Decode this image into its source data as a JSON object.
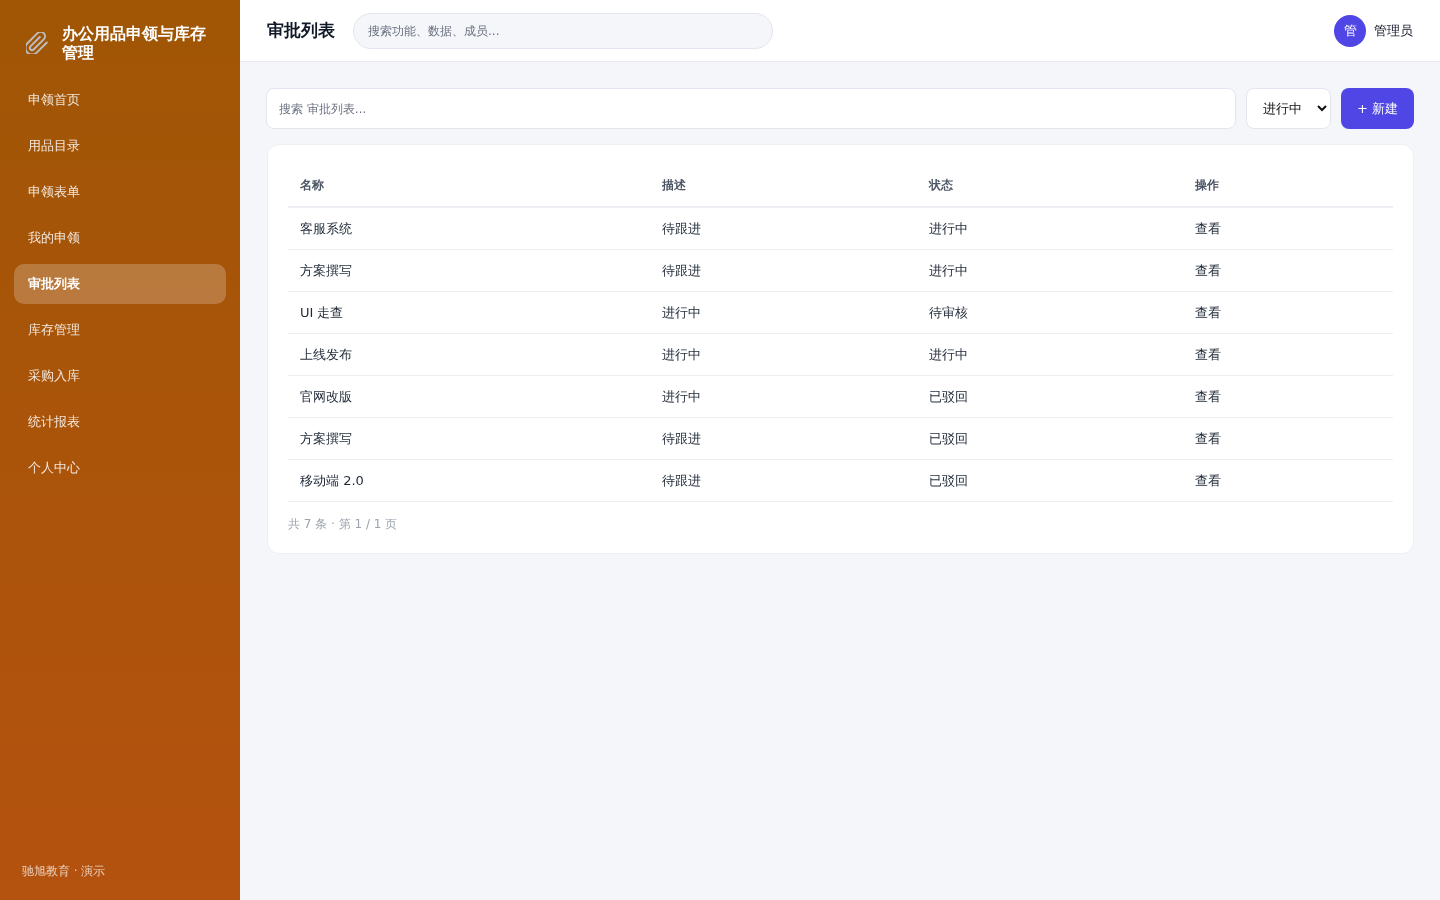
{
  "sidebar": {
    "brand": {
      "title": "办公用品申领与库存管理"
    },
    "items": [
      {
        "label": "申领首页",
        "selected": false
      },
      {
        "label": "用品目录",
        "selected": false
      },
      {
        "label": "申领表单",
        "selected": false
      },
      {
        "label": "我的申领",
        "selected": false
      },
      {
        "label": "审批列表",
        "selected": true
      },
      {
        "label": "库存管理",
        "selected": false
      },
      {
        "label": "采购入库",
        "selected": false
      },
      {
        "label": "统计报表",
        "selected": false
      },
      {
        "label": "个人中心",
        "selected": false
      }
    ],
    "footer": "驰旭教育 · 演示"
  },
  "header": {
    "title": "审批列表",
    "search": {
      "placeholder": "搜索功能、数据、成员..."
    },
    "user": {
      "avatar": "管",
      "name": "管理员"
    }
  },
  "toolbar": {
    "search": {
      "placeholder": "搜索 审批列表..."
    },
    "filter": {
      "value": "进行中"
    },
    "new_button": "+ 新建"
  },
  "table": {
    "columns": [
      "名称",
      "描述",
      "状态",
      "操作"
    ],
    "rows": [
      {
        "name": "客服系统",
        "description": "待跟进",
        "status": "进行中",
        "action": "查看"
      },
      {
        "name": "方案撰写",
        "description": "待跟进",
        "status": "进行中",
        "action": "查看"
      },
      {
        "name": "UI 走查",
        "description": "进行中",
        "status": "待审核",
        "action": "查看"
      },
      {
        "name": "上线发布",
        "description": "进行中",
        "status": "进行中",
        "action": "查看"
      },
      {
        "name": "官网改版",
        "description": "进行中",
        "status": "已驳回",
        "action": "查看"
      },
      {
        "name": "方案撰写",
        "description": "待跟进",
        "status": "已驳回",
        "action": "查看"
      },
      {
        "name": "移动端 2.0",
        "description": "待跟进",
        "status": "已驳回",
        "action": "查看"
      }
    ],
    "pagination": "共 7 条 · 第 1 / 1 页"
  }
}
